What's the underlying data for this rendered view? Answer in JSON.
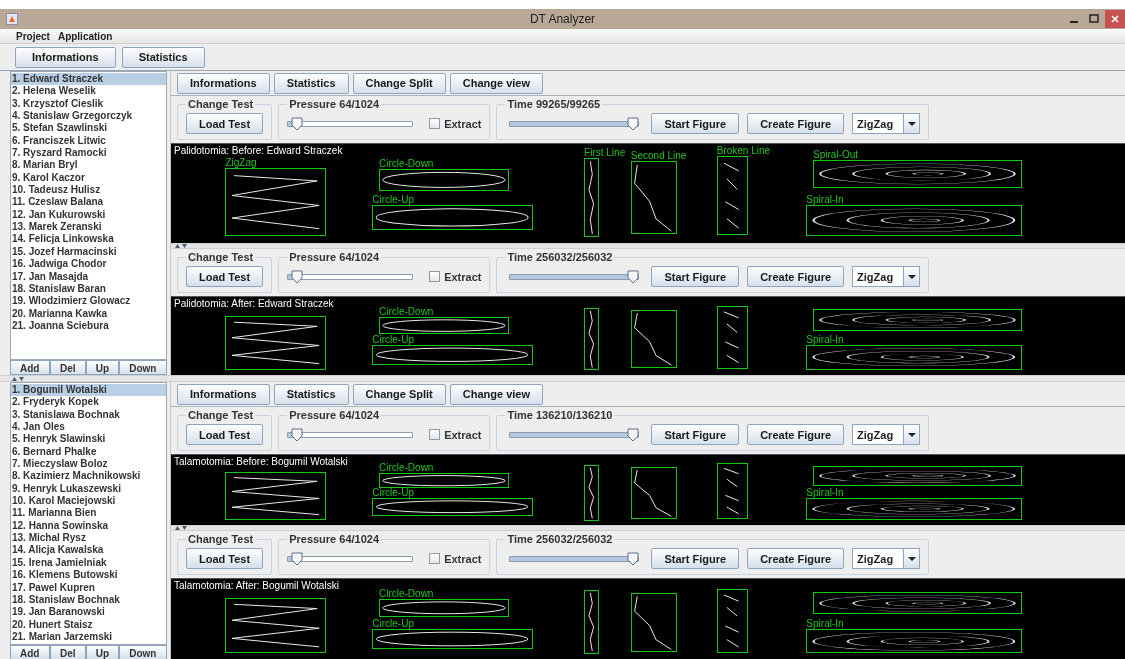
{
  "window": {
    "title": "DT Analyzer"
  },
  "menu": [
    "Project",
    "Application"
  ],
  "toolbar": [
    "Informations",
    "Statistics"
  ],
  "groups": [
    {
      "patients": [
        {
          "name": "1. Edward Straczek",
          "selected": true
        },
        {
          "name": "2. Helena Weselik",
          "selected": false
        },
        {
          "name": "3. Krzysztof Cieslik",
          "selected": false
        },
        {
          "name": "4. Stanislaw Grzegorczyk",
          "selected": false
        },
        {
          "name": "5. Stefan  Szawlinski",
          "selected": false
        },
        {
          "name": "6. Franciszek Litwic",
          "selected": false
        },
        {
          "name": "7. Ryszard Ramocki",
          "selected": false
        },
        {
          "name": "8. Marian Bryl",
          "selected": false
        },
        {
          "name": "9. Karol Kaczor",
          "selected": false
        },
        {
          "name": "10. Tadeusz Hulisz",
          "selected": false
        },
        {
          "name": "11. Czeslaw Balana",
          "selected": false
        },
        {
          "name": "12. Jan Kukurowski",
          "selected": false
        },
        {
          "name": "13. Marek Zeranski",
          "selected": false
        },
        {
          "name": "14. Felicja Linkowska",
          "selected": false
        },
        {
          "name": "15. Jozef Harmacinski",
          "selected": false
        },
        {
          "name": "16. Jadwiga Chodor",
          "selected": false
        },
        {
          "name": "17. Jan Masajda",
          "selected": false
        },
        {
          "name": "18. Stanislaw Baran",
          "selected": false
        },
        {
          "name": "19. Wlodzimierz Glowacz",
          "selected": false
        },
        {
          "name": "20. Marianna Kawka",
          "selected": false
        },
        {
          "name": "21. Joanna Sciebura",
          "selected": false
        }
      ],
      "list_buttons": [
        "Add",
        "Del",
        "Up",
        "Down"
      ],
      "toolbar": [
        "Informations",
        "Statistics",
        "Change Split",
        "Change view"
      ],
      "panes": [
        {
          "test_group": "Change Test",
          "load_button": "Load Test",
          "pressure": {
            "label": "Pressure 64/1024",
            "level": 0.03
          },
          "extract": {
            "label": "Extract",
            "checked": false
          },
          "time": {
            "label": "Time 99265/99265",
            "level": 1
          },
          "start_button": "Start Figure",
          "create_button": "Create Figure",
          "figure_select": "ZigZag",
          "canvas": {
            "title": "Palidotomia: Before: Edward Straczek",
            "figures": [
              {
                "kind": "zigzag",
                "label": "ZigZag"
              },
              {
                "kind": "circle-down",
                "label": "Circle-Down"
              },
              {
                "kind": "first-line",
                "label": "First Line"
              },
              {
                "kind": "second-line",
                "label": "Second Line"
              },
              {
                "kind": "broken-line",
                "label": "Broken Line"
              },
              {
                "kind": "spiral-out",
                "label": "Spiral-Out"
              },
              {
                "kind": "circle-up",
                "label": "Circle-Up"
              },
              {
                "kind": "spiral-in",
                "label": "Spiral-In"
              }
            ]
          }
        },
        {
          "test_group": "Change Test",
          "load_button": "Load Test",
          "pressure": {
            "label": "Pressure 64/1024",
            "level": 0.03
          },
          "extract": {
            "label": "Extract",
            "checked": false
          },
          "time": {
            "label": "Time 256032/256032",
            "level": 1
          },
          "start_button": "Start Figure",
          "create_button": "Create Figure",
          "figure_select": "ZigZag",
          "canvas": {
            "title": "Palidotomia: After: Edward Straczek",
            "figures": [
              {
                "kind": "zigzag"
              },
              {
                "kind": "circle-down",
                "label": "Circle-Down"
              },
              {
                "kind": "first-line"
              },
              {
                "kind": "second-line"
              },
              {
                "kind": "broken-line"
              },
              {
                "kind": "spiral-out"
              },
              {
                "kind": "circle-up",
                "label": "Circle-Up"
              },
              {
                "kind": "spiral-in",
                "label": "Spiral-In"
              }
            ]
          }
        }
      ]
    },
    {
      "patients": [
        {
          "name": "1. Bogumil Wotalski",
          "selected": true
        },
        {
          "name": "2. Fryderyk Kopek",
          "selected": false
        },
        {
          "name": "3. Stanislawa Bochnak",
          "selected": false
        },
        {
          "name": "4. Jan Oles",
          "selected": false
        },
        {
          "name": "5. Henryk Slawinski",
          "selected": false
        },
        {
          "name": "6. Bernard Phalke",
          "selected": false
        },
        {
          "name": "7. Mieczyslaw Boloz",
          "selected": false
        },
        {
          "name": "8. Kazimierz Machnikowski",
          "selected": false
        },
        {
          "name": "9. Henryk Lukaszewski",
          "selected": false
        },
        {
          "name": "10. Karol Maciejowski",
          "selected": false
        },
        {
          "name": "11. Marianna Bien",
          "selected": false
        },
        {
          "name": "12. Hanna Sowinska",
          "selected": false
        },
        {
          "name": "13. Michal Rysz",
          "selected": false
        },
        {
          "name": "14. Alicja Kawalska",
          "selected": false
        },
        {
          "name": "15. Irena Jamielniak",
          "selected": false
        },
        {
          "name": "16. Klemens Butowski",
          "selected": false
        },
        {
          "name": "17. Pawel Kupren",
          "selected": false
        },
        {
          "name": "18. Stanislaw Bochnak",
          "selected": false
        },
        {
          "name": "19. Jan Baranowski",
          "selected": false
        },
        {
          "name": "20. Hunert Staisz",
          "selected": false
        },
        {
          "name": "21. Marian Jarzemski",
          "selected": false
        }
      ],
      "list_buttons": [
        "Add",
        "Del",
        "Up",
        "Down"
      ],
      "toolbar": [
        "Informations",
        "Statistics",
        "Change Split",
        "Change view"
      ],
      "panes": [
        {
          "test_group": "Change Test",
          "load_button": "Load Test",
          "pressure": {
            "label": "Pressure 64/1024",
            "level": 0.03
          },
          "extract": {
            "label": "Extract",
            "checked": false
          },
          "time": {
            "label": "Time 136210/136210",
            "level": 1
          },
          "start_button": "Start Figure",
          "create_button": "Create Figure",
          "figure_select": "ZigZag",
          "canvas": {
            "title": "Talamotomia: Before: Bogumil Wotalski",
            "figures": [
              {
                "kind": "zigzag"
              },
              {
                "kind": "circle-down",
                "label": "Circle-Down"
              },
              {
                "kind": "first-line"
              },
              {
                "kind": "second-line"
              },
              {
                "kind": "broken-line"
              },
              {
                "kind": "spiral-out"
              },
              {
                "kind": "circle-up",
                "label": "Circle-Up"
              },
              {
                "kind": "spiral-in",
                "label": "Spiral-In"
              }
            ]
          }
        },
        {
          "test_group": "Change Test",
          "load_button": "Load Test",
          "pressure": {
            "label": "Pressure 64/1024",
            "level": 0.03
          },
          "extract": {
            "label": "Extract",
            "checked": false
          },
          "time": {
            "label": "Time 256032/256032",
            "level": 1
          },
          "start_button": "Start Figure",
          "create_button": "Create Figure",
          "figure_select": "ZigZag",
          "canvas": {
            "title": "Talamotomia: After: Bogumil Wotalski",
            "figures": [
              {
                "kind": "zigzag"
              },
              {
                "kind": "circle-down",
                "label": "Circle-Down"
              },
              {
                "kind": "first-line"
              },
              {
                "kind": "second-line"
              },
              {
                "kind": "broken-line"
              },
              {
                "kind": "spiral-out"
              },
              {
                "kind": "circle-up",
                "label": "Circle-Up"
              },
              {
                "kind": "spiral-in",
                "label": "Spiral-In"
              }
            ]
          }
        }
      ]
    }
  ]
}
